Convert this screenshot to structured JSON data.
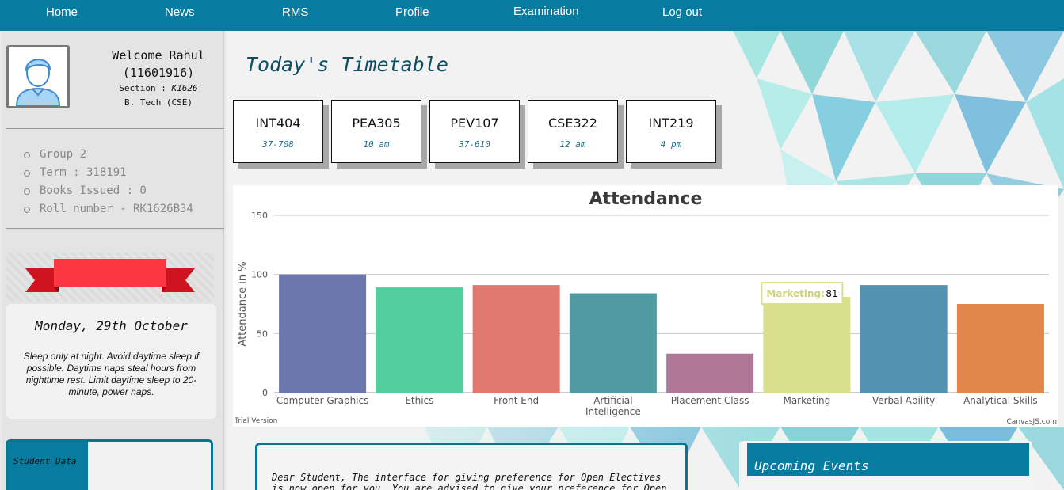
{
  "nav": {
    "items": [
      {
        "label": "Home"
      },
      {
        "label": "News"
      },
      {
        "label": "RMS"
      },
      {
        "label": "Profile"
      },
      {
        "label": "Examination"
      },
      {
        "label": "Log out"
      }
    ]
  },
  "sidebar": {
    "welcome": "Welcome Rahul",
    "reg_no": "(11601916)",
    "section_label": "Section :",
    "section_value": "K1626",
    "program": "B. Tech (CSE)",
    "info": [
      {
        "label": "Group 2"
      },
      {
        "label": "Term : 318191"
      },
      {
        "label": "Books Issued : 0"
      },
      {
        "label": "Roll number - RK1626B34"
      }
    ],
    "date": "Monday, 29th October",
    "tip": "Sleep only at night. Avoid daytime sleep if possible. Daytime naps steal hours from nighttime rest. Limit daytime sleep to 20-minute, power naps.",
    "student_data_label": "Student Data"
  },
  "main": {
    "timetable_title": "Today's Timetable",
    "timetable": [
      {
        "code": "INT404",
        "info": "37-708"
      },
      {
        "code": "PEA305",
        "info": "10 am"
      },
      {
        "code": "PEV107",
        "info": "37-610"
      },
      {
        "code": "CSE322",
        "info": "12 am"
      },
      {
        "code": "INT219",
        "info": "4 pm"
      }
    ],
    "notice": "Dear Student, The interface for giving preference for Open Electives is now open for you. You are advised to give your preference for Open",
    "events_title": "Upcoming Events"
  },
  "colors": {
    "nav_bg": "#087ba0",
    "accent": "#0a7590",
    "title_color": "#0d4f62"
  },
  "chart_data": {
    "type": "bar",
    "title": "Attendance",
    "ylabel": "Attendance in %",
    "xlabel": "",
    "ylim": [
      0,
      150
    ],
    "yticks": [
      0,
      50,
      100,
      150
    ],
    "categories": [
      "Computer Graphics",
      "Ethics",
      "Front End",
      "Artificial Intelligence",
      "Placement Class",
      "Marketing",
      "Verbal Ability",
      "Analytical Skills"
    ],
    "category_lines": [
      [
        "Computer Graphics"
      ],
      [
        "Ethics"
      ],
      [
        "Front End"
      ],
      [
        "Artificial",
        "Intelligence"
      ],
      [
        "Placement Class"
      ],
      [
        "Marketing"
      ],
      [
        "Verbal Ability"
      ],
      [
        "Analytical Skills"
      ]
    ],
    "values": [
      100,
      89,
      91,
      84,
      33,
      81,
      91,
      75
    ],
    "colors": [
      "#6c77ad",
      "#52cf9e",
      "#e07870",
      "#4f9aa0",
      "#b07897",
      "#d8e08b",
      "#5393b1",
      "#e0874c"
    ],
    "tooltip": {
      "label": "Marketing:",
      "value": "81"
    },
    "footer_left": "Trial Version",
    "footer_right": "CanvasJS.com",
    "grid": true,
    "legend": "none"
  }
}
